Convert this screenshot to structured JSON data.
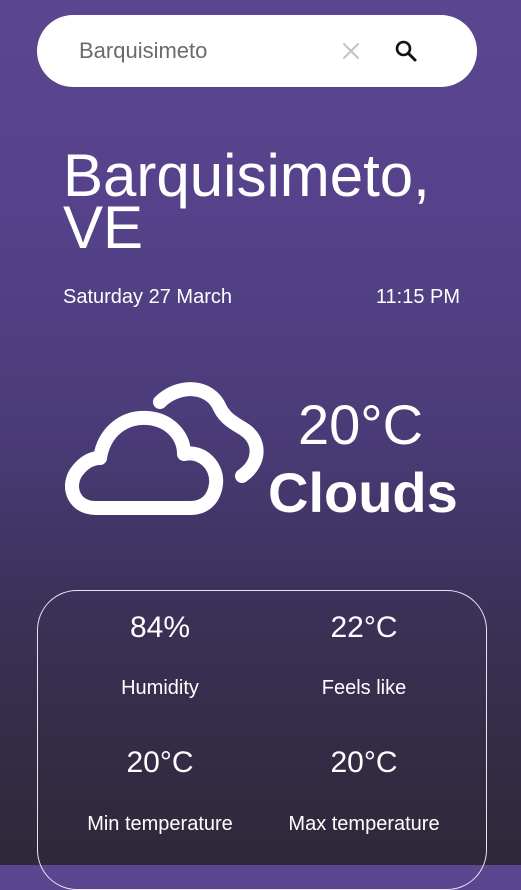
{
  "search": {
    "value": "Barquisimeto",
    "clear_icon": "close-icon",
    "search_icon": "search-icon"
  },
  "location": {
    "city": "Barquisimeto, VE"
  },
  "datetime": {
    "date": "Saturday 27 March",
    "time": "11:15 PM"
  },
  "current": {
    "icon": "clouds-icon",
    "temperature": "20°C",
    "condition": "Clouds"
  },
  "details": [
    {
      "value": "84%",
      "label": "Humidity"
    },
    {
      "value": "22°C",
      "label": "Feels like"
    },
    {
      "value": "20°C",
      "label": "Min temperature"
    },
    {
      "value": "20°C",
      "label": "Max temperature"
    }
  ],
  "colors": {
    "background_top": "#5b4690",
    "background_bottom": "#2e2838",
    "text": "#ffffff",
    "search_bg": "#ffffff",
    "search_text": "#6b6b6b",
    "card_border": "#e8e4f0"
  }
}
